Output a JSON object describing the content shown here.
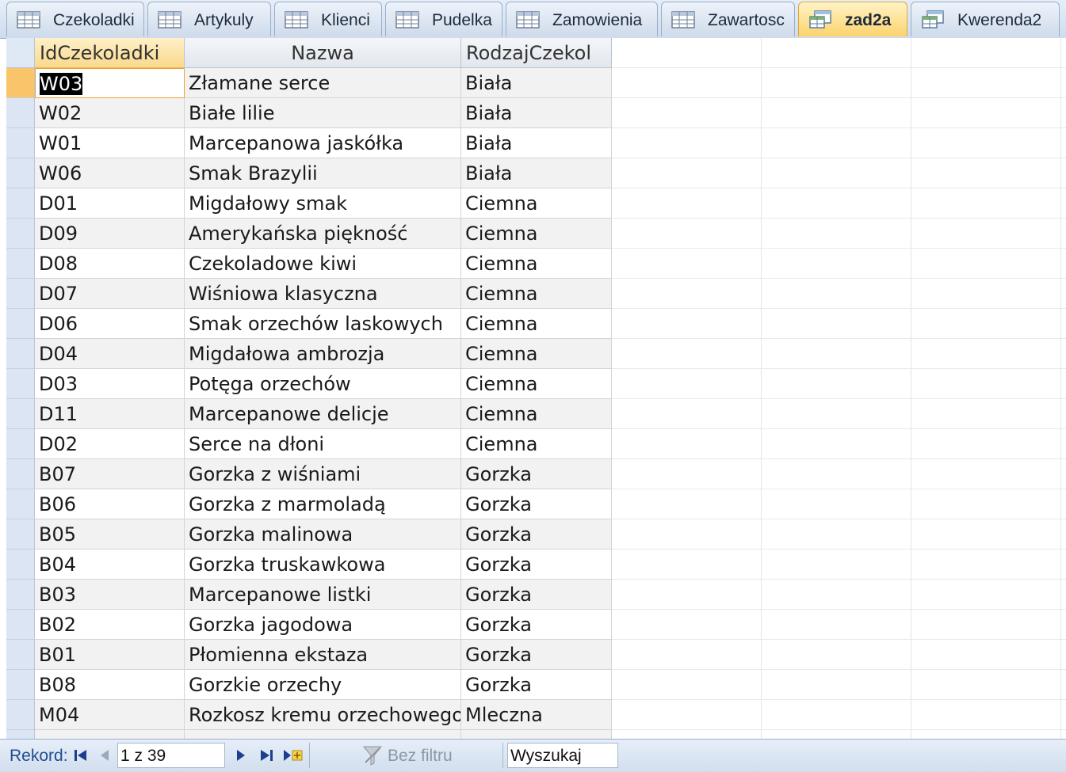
{
  "tabs": [
    {
      "label": "Czekoladki",
      "kind": "table-icon",
      "active": false
    },
    {
      "label": "Artykuly",
      "kind": "table-icon",
      "active": false
    },
    {
      "label": "Klienci",
      "kind": "table-icon",
      "active": false
    },
    {
      "label": "Pudelka",
      "kind": "table-icon",
      "active": false
    },
    {
      "label": "Zamowienia",
      "kind": "table-icon",
      "active": false
    },
    {
      "label": "Zawartosc",
      "kind": "table-icon",
      "active": false
    },
    {
      "label": "zad2a",
      "kind": "query-icon",
      "active": true
    },
    {
      "label": "Kwerenda2",
      "kind": "query-icon",
      "active": false
    }
  ],
  "columns": [
    "IdCzekoladki",
    "Nazwa",
    "RodzajCzekol"
  ],
  "rows": [
    [
      "W03",
      "Złamane serce",
      "Biała"
    ],
    [
      "W02",
      "Białe lilie",
      "Biała"
    ],
    [
      "W01",
      "Marcepanowa jaskółka",
      "Biała"
    ],
    [
      "W06",
      "Smak Brazylii",
      "Biała"
    ],
    [
      "D01",
      "Migdałowy smak",
      "Ciemna"
    ],
    [
      "D09",
      "Amerykańska piękność",
      "Ciemna"
    ],
    [
      "D08",
      "Czekoladowe kiwi",
      "Ciemna"
    ],
    [
      "D07",
      "Wiśniowa klasyczna",
      "Ciemna"
    ],
    [
      "D06",
      "Smak orzechów laskowych",
      "Ciemna"
    ],
    [
      "D04",
      "Migdałowa ambrozja",
      "Ciemna"
    ],
    [
      "D03",
      "Potęga orzechów",
      "Ciemna"
    ],
    [
      "D11",
      "Marcepanowe delicje",
      "Ciemna"
    ],
    [
      "D02",
      "Serce na dłoni",
      "Ciemna"
    ],
    [
      "B07",
      "Gorzka z wiśniami",
      "Gorzka"
    ],
    [
      "B06",
      "Gorzka z marmoladą",
      "Gorzka"
    ],
    [
      "B05",
      "Gorzka malinowa",
      "Gorzka"
    ],
    [
      "B04",
      "Gorzka truskawkowa",
      "Gorzka"
    ],
    [
      "B03",
      "Marcepanowe listki",
      "Gorzka"
    ],
    [
      "B02",
      "Gorzka jagodowa",
      "Gorzka"
    ],
    [
      "B01",
      "Płomienna ekstaza",
      "Gorzka"
    ],
    [
      "B08",
      "Gorzkie orzechy",
      "Gorzka"
    ],
    [
      "M04",
      "Rozkosz kremu orzechowego",
      "Mleczna"
    ]
  ],
  "current_row_index": 0,
  "navigation": {
    "record_label": "Rekord:",
    "record_position": "1 z 39",
    "filter_label": "Bez filtru",
    "search_placeholder": "Wyszukaj",
    "icons": [
      "first-record-icon",
      "previous-record-icon",
      "next-record-icon",
      "last-record-icon",
      "new-record-icon",
      "filter-icon"
    ]
  },
  "colors": {
    "active_tab": "#fcd36e",
    "current_record_selector": "#f9c46a",
    "alt_row": "#f2f2f2"
  }
}
